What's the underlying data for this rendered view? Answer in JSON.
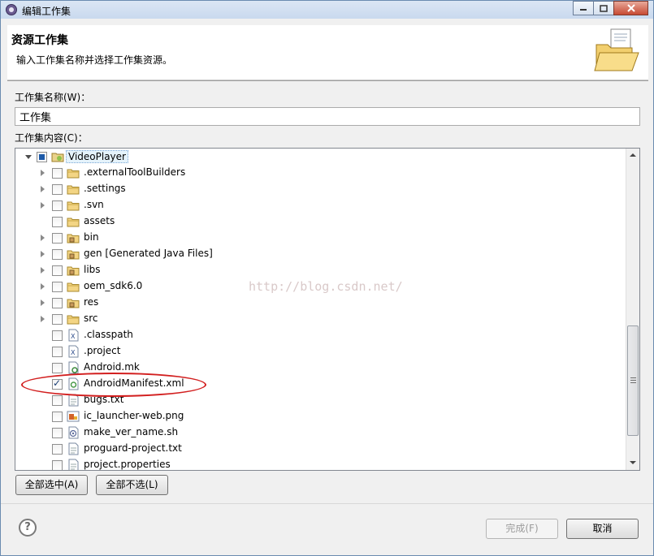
{
  "window": {
    "title": "编辑工作集",
    "icon": "eclipse-gear-icon"
  },
  "header": {
    "title": "资源工作集",
    "description": "输入工作集名称并选择工作集资源。",
    "icon": "folder-document-icon"
  },
  "name_field": {
    "label": "工作集名称(W)：",
    "value": "工作集"
  },
  "content": {
    "label": "工作集内容(C)：",
    "root": {
      "label": "VideoPlayer",
      "expanded": true,
      "check_state": "partial"
    },
    "items": [
      {
        "label": ".externalToolBuilders",
        "icon": "folder-icon",
        "expandable": true,
        "checked": false
      },
      {
        "label": ".settings",
        "icon": "folder-icon",
        "expandable": true,
        "checked": false
      },
      {
        "label": ".svn",
        "icon": "folder-icon",
        "expandable": true,
        "checked": false
      },
      {
        "label": "assets",
        "icon": "folder-icon",
        "expandable": false,
        "checked": false
      },
      {
        "label": "bin",
        "icon": "package-folder-icon",
        "expandable": true,
        "checked": false
      },
      {
        "label": "gen [Generated Java Files]",
        "icon": "package-folder-icon",
        "expandable": true,
        "checked": false
      },
      {
        "label": "libs",
        "icon": "package-folder-icon",
        "expandable": true,
        "checked": false
      },
      {
        "label": "oem_sdk6.0",
        "icon": "folder-icon",
        "expandable": true,
        "checked": false
      },
      {
        "label": "res",
        "icon": "package-folder-icon",
        "expandable": true,
        "checked": false
      },
      {
        "label": "src",
        "icon": "folder-icon",
        "expandable": true,
        "checked": false
      },
      {
        "label": ".classpath",
        "icon": "xml-file-icon",
        "expandable": false,
        "checked": false
      },
      {
        "label": ".project",
        "icon": "xml-file-icon",
        "expandable": false,
        "checked": false
      },
      {
        "label": "Android.mk",
        "icon": "mk-file-icon",
        "expandable": false,
        "checked": false
      },
      {
        "label": "AndroidManifest.xml",
        "icon": "android-manifest-icon",
        "expandable": false,
        "checked": true
      },
      {
        "label": "bugs.txt",
        "icon": "text-file-icon",
        "expandable": false,
        "checked": false
      },
      {
        "label": "ic_launcher-web.png",
        "icon": "image-file-icon",
        "expandable": false,
        "checked": false
      },
      {
        "label": "make_ver_name.sh",
        "icon": "script-file-icon",
        "expandable": false,
        "checked": false
      },
      {
        "label": "proguard-project.txt",
        "icon": "text-file-icon",
        "expandable": false,
        "checked": false
      },
      {
        "label": "project.properties",
        "icon": "text-file-icon",
        "expandable": false,
        "checked": false
      }
    ]
  },
  "watermark": "http://blog.csdn.net/",
  "buttons": {
    "select_all": "全部选中(A)",
    "deselect_all": "全部不选(L)",
    "finish": "完成(F)",
    "cancel": "取消"
  },
  "help_icon": "?",
  "colors": {
    "highlight": "#d21f1f",
    "selection": "#e5f3fb"
  }
}
